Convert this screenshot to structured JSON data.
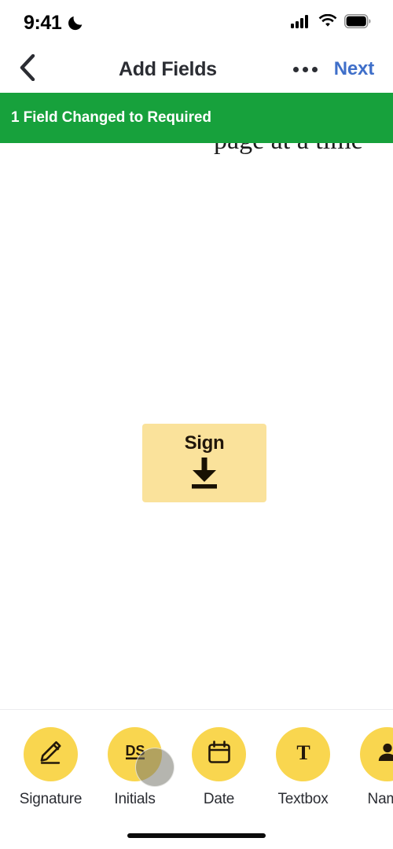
{
  "status_bar": {
    "time": "9:41",
    "dnd_icon": "crescent-moon-icon",
    "signal_icon": "cellular-signal-icon",
    "wifi_icon": "wifi-icon",
    "battery_icon": "battery-full-icon"
  },
  "nav_bar": {
    "back_icon": "chevron-left-icon",
    "title": "Add Fields",
    "more_icon": "more-options-icon",
    "next_label": "Next",
    "next_color": "#3f6fc9"
  },
  "toast": {
    "message": "1 Field Changed to Required",
    "background_color": "#17a13c",
    "text_color": "#ffffff"
  },
  "document": {
    "visible_text": "page at a time"
  },
  "sign_field": {
    "label": "Sign",
    "icon": "arrow-down-to-line-icon",
    "background_color": "#fae29b",
    "text_color": "#20160a"
  },
  "toolbar": {
    "accent_color": "#f9d64f",
    "items": [
      {
        "label": "Signature",
        "icon": "pen-signature-icon"
      },
      {
        "label": "Initials",
        "icon": "initials-ds-icon"
      },
      {
        "label": "Date",
        "icon": "calendar-icon"
      },
      {
        "label": "Textbox",
        "icon": "text-t-icon"
      },
      {
        "label": "Name",
        "icon": "person-icon"
      }
    ]
  },
  "home_indicator": "home-indicator-bar"
}
